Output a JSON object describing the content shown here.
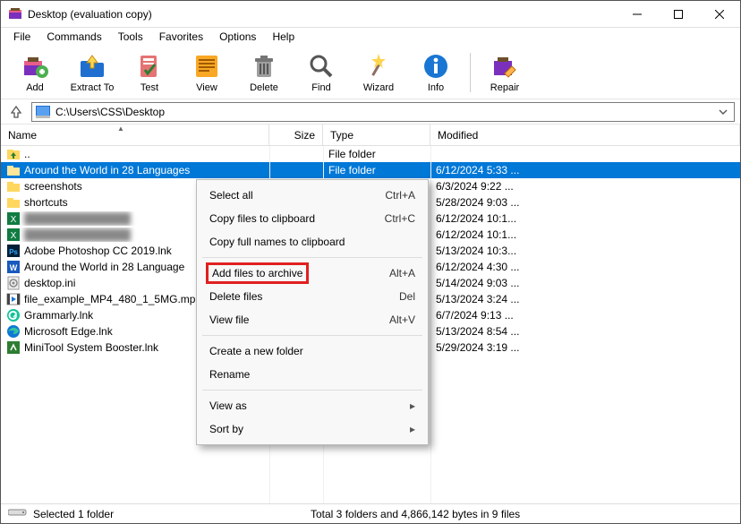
{
  "window": {
    "title": "Desktop (evaluation copy)"
  },
  "menubar": [
    "File",
    "Commands",
    "Tools",
    "Favorites",
    "Options",
    "Help"
  ],
  "toolbar": [
    {
      "name": "add",
      "label": "Add"
    },
    {
      "name": "extract-to",
      "label": "Extract To"
    },
    {
      "name": "test",
      "label": "Test"
    },
    {
      "name": "view",
      "label": "View"
    },
    {
      "name": "delete",
      "label": "Delete"
    },
    {
      "name": "find",
      "label": "Find"
    },
    {
      "name": "wizard",
      "label": "Wizard"
    },
    {
      "name": "info",
      "label": "Info"
    },
    {
      "name": "sep",
      "label": ""
    },
    {
      "name": "repair",
      "label": "Repair"
    }
  ],
  "address": {
    "path": "C:\\Users\\CSS\\Desktop"
  },
  "columns": {
    "name": "Name",
    "size": "Size",
    "type": "Type",
    "modified": "Modified"
  },
  "rows": [
    {
      "icon": "updir",
      "name": "..",
      "size": "",
      "type": "File folder",
      "mod": "",
      "selected": false
    },
    {
      "icon": "folder",
      "name": "Around the World in 28 Languages",
      "size": "",
      "type": "File folder",
      "mod": "6/12/2024 5:33 ...",
      "selected": true
    },
    {
      "icon": "folder",
      "name": "screenshots",
      "size": "",
      "type": "",
      "mod": "6/3/2024 9:22 ...",
      "selected": false
    },
    {
      "icon": "folder",
      "name": "shortcuts",
      "size": "",
      "type": "",
      "mod": "5/28/2024 9:03 ...",
      "selected": false
    },
    {
      "icon": "excel",
      "name": "",
      "size": "",
      "type": "",
      "mod": "6/12/2024 10:1...",
      "selected": false,
      "obscured": true
    },
    {
      "icon": "excel",
      "name": "",
      "size": "",
      "type": "",
      "mod": "6/12/2024 10:1...",
      "selected": false,
      "obscured": true
    },
    {
      "icon": "ps",
      "name": "Adobe Photoshop CC 2019.lnk",
      "size": "",
      "type": "",
      "mod": "5/13/2024 10:3...",
      "selected": false
    },
    {
      "icon": "docx",
      "name": "Around the World in 28 Language",
      "size": "",
      "type": "",
      "mod": "6/12/2024 4:30 ...",
      "selected": false
    },
    {
      "icon": "ini",
      "name": "desktop.ini",
      "size": "",
      "type": "",
      "mod": "5/14/2024 9:03 ...",
      "selected": false
    },
    {
      "icon": "mp4",
      "name": "file_example_MP4_480_1_5MG.mp",
      "size": "",
      "type": "",
      "mod": "5/13/2024 3:24 ...",
      "selected": false
    },
    {
      "icon": "grammarly",
      "name": "Grammarly.lnk",
      "size": "",
      "type": "",
      "mod": "6/7/2024 9:13 ...",
      "selected": false
    },
    {
      "icon": "edge",
      "name": "Microsoft Edge.lnk",
      "size": "",
      "type": "",
      "mod": "5/13/2024 8:54 ...",
      "selected": false
    },
    {
      "icon": "minitool",
      "name": "MiniTool System Booster.lnk",
      "size": "",
      "type": "",
      "mod": "5/29/2024 3:19 ...",
      "selected": false
    }
  ],
  "contextMenu": {
    "groups": [
      [
        {
          "label": "Select all",
          "shortcut": "Ctrl+A"
        },
        {
          "label": "Copy files to clipboard",
          "shortcut": "Ctrl+C"
        },
        {
          "label": "Copy full names to clipboard",
          "shortcut": ""
        }
      ],
      [
        {
          "label": "Add files to archive",
          "shortcut": "Alt+A",
          "highlighted": true
        },
        {
          "label": "Delete files",
          "shortcut": "Del"
        },
        {
          "label": "View file",
          "shortcut": "Alt+V"
        }
      ],
      [
        {
          "label": "Create a new folder",
          "shortcut": ""
        },
        {
          "label": "Rename",
          "shortcut": ""
        }
      ],
      [
        {
          "label": "View as",
          "submenu": true
        },
        {
          "label": "Sort by",
          "submenu": true
        }
      ]
    ]
  },
  "status": {
    "selected": "Selected 1 folder",
    "total": "Total 3 folders and 4,866,142 bytes in 9 files"
  }
}
